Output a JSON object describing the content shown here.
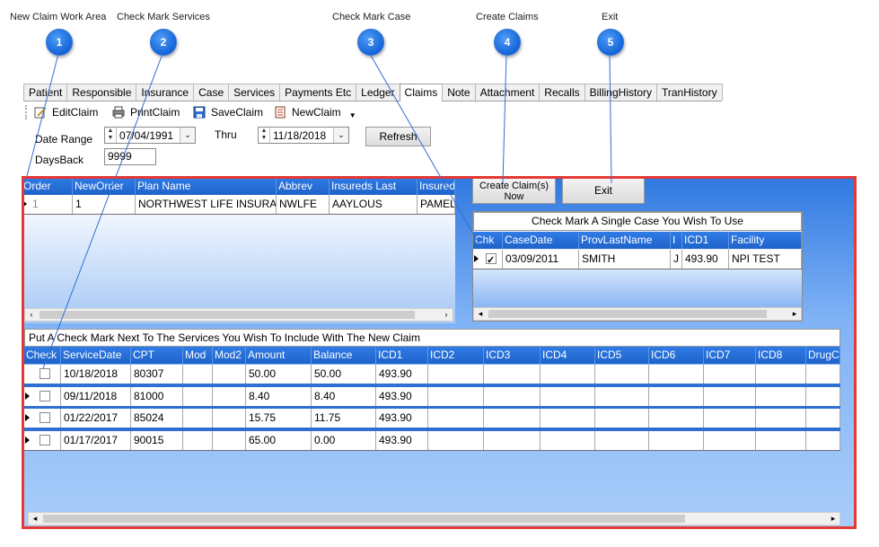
{
  "callouts": [
    {
      "num": "1",
      "label": "New Claim Work Area"
    },
    {
      "num": "2",
      "label": "Check Mark Services"
    },
    {
      "num": "3",
      "label": "Check Mark Case"
    },
    {
      "num": "4",
      "label": "Create Claims"
    },
    {
      "num": "5",
      "label": "Exit"
    }
  ],
  "tabs": [
    "Patient",
    "Responsible",
    "Insurance",
    "Case",
    "Services",
    "Payments Etc",
    "Ledger",
    "Claims",
    "Note",
    "Attachment",
    "Recalls",
    "BillingHistory",
    "TranHistory"
  ],
  "active_tab": "Claims",
  "toolbar": {
    "edit": "EditClaim",
    "print": "PrintClaim",
    "save": "SaveClaim",
    "new": "NewClaim"
  },
  "filters": {
    "date_range_label": "Date Range",
    "date_from": "07/04/1991",
    "thru_label": "Thru",
    "date_to": "11/18/2018",
    "refresh": "Refresh",
    "days_back_label": "DaysBack",
    "days_back": "9999"
  },
  "actions": {
    "create": "Create Claim(s) Now",
    "exit": "Exit"
  },
  "insurance_grid": {
    "headers": [
      "Order",
      "NewOrder",
      "Plan Name",
      "Abbrev",
      "Insureds Last",
      "Insured"
    ],
    "rows": [
      [
        "1",
        "1",
        "NORTHWEST LIFE INSURA",
        "NWLFE",
        "AAYLOUS",
        "PAMEL"
      ]
    ]
  },
  "case_panel": {
    "title": "Check Mark A Single Case You Wish To Use",
    "headers": [
      "Chk",
      "CaseDate",
      "ProvLastName",
      "I",
      "ICD1",
      "Facility"
    ],
    "rows": [
      {
        "checked": true,
        "cells": [
          "03/09/2011",
          "SMITH",
          "J",
          "493.90",
          "NPI TEST"
        ]
      }
    ]
  },
  "services": {
    "title": "Put A Check Mark Next To The Services You Wish To Include With The New Claim",
    "headers": [
      "Check",
      "ServiceDate",
      "CPT",
      "Mod",
      "Mod2",
      "Amount",
      "Balance",
      "ICD1",
      "ICD2",
      "ICD3",
      "ICD4",
      "ICD5",
      "ICD6",
      "ICD7",
      "ICD8",
      "DrugCo"
    ],
    "rows": [
      {
        "checked": false,
        "cells": [
          "10/18/2018",
          "80307",
          "",
          "",
          "50.00",
          "50.00",
          "493.90",
          "",
          "",
          "",
          "",
          "",
          "",
          "",
          ""
        ]
      },
      {
        "checked": false,
        "cells": [
          "09/11/2018",
          "81000",
          "",
          "",
          "8.40",
          "8.40",
          "493.90",
          "",
          "",
          "",
          "",
          "",
          "",
          "",
          ""
        ]
      },
      {
        "checked": false,
        "cells": [
          "01/22/2017",
          "85024",
          "",
          "",
          "15.75",
          "11.75",
          "493.90",
          "",
          "",
          "",
          "",
          "",
          "",
          "",
          ""
        ]
      },
      {
        "checked": false,
        "cells": [
          "01/17/2017",
          "90015",
          "",
          "",
          "65.00",
          "0.00",
          "493.90",
          "",
          "",
          "",
          "",
          "",
          "",
          "",
          ""
        ]
      }
    ]
  }
}
